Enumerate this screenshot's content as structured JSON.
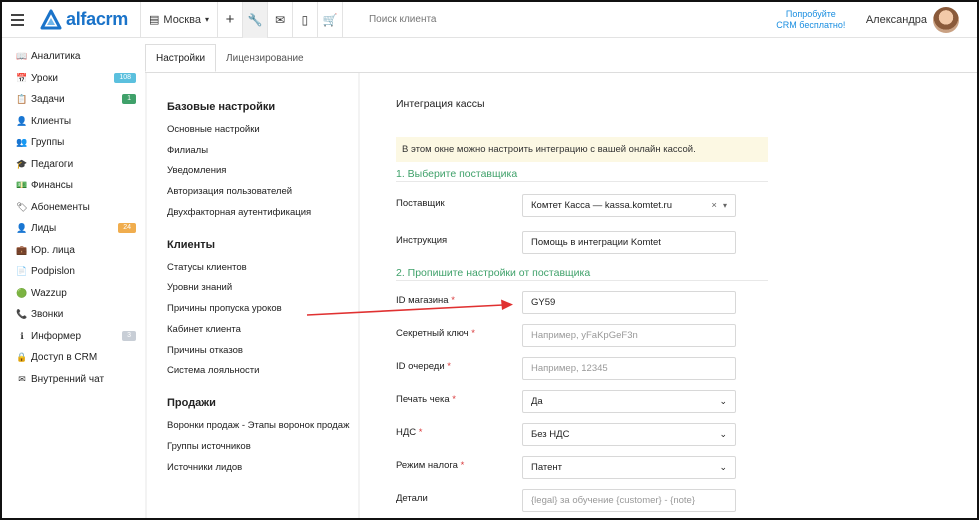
{
  "app": {
    "logo_text": "alfacrm",
    "city": "Москва",
    "search_placeholder": "Поиск клиента",
    "try_free_line1": "Попробуйте",
    "try_free_line2": "CRM бесплатно!",
    "user_name": "Александра",
    "accent": "#1a73c9"
  },
  "sidebar": {
    "items": [
      {
        "label": "Аналитика",
        "icon": "book-icon",
        "glyph": "📖"
      },
      {
        "label": "Уроки",
        "icon": "calendar-icon",
        "glyph": "📅",
        "badge": "108",
        "badge_color": "#5bc0de"
      },
      {
        "label": "Задачи",
        "icon": "clipboard-icon",
        "glyph": "📋",
        "badge": "1",
        "badge_color": "#3fa16a"
      },
      {
        "label": "Клиенты",
        "icon": "user-icon",
        "glyph": "👤"
      },
      {
        "label": "Группы",
        "icon": "users-icon",
        "glyph": "👥"
      },
      {
        "label": "Педагоги",
        "icon": "graduation-cap-icon",
        "glyph": "🎓"
      },
      {
        "label": "Финансы",
        "icon": "money-icon",
        "glyph": "💵"
      },
      {
        "label": "Абонементы",
        "icon": "tag-icon",
        "glyph": "🏷"
      },
      {
        "label": "Лиды",
        "icon": "user-plus-icon",
        "glyph": "👤",
        "badge": "24",
        "badge_color": "#f0ad4e"
      },
      {
        "label": "Юр. лица",
        "icon": "briefcase-icon",
        "glyph": "💼"
      },
      {
        "label": "Podpislon",
        "icon": "file-icon",
        "glyph": "📄"
      },
      {
        "label": "Wazzup",
        "icon": "whatsapp-icon",
        "glyph": "🟢"
      },
      {
        "label": "Звонки",
        "icon": "phone-icon",
        "glyph": "📞"
      },
      {
        "label": "Информер",
        "icon": "info-icon",
        "glyph": "ℹ",
        "badge": "3",
        "badge_color": "#c8ced6"
      },
      {
        "label": "Доступ в CRM",
        "icon": "lock-icon",
        "glyph": "🔒"
      },
      {
        "label": "Внутренний чат",
        "icon": "envelope-icon",
        "glyph": "✉"
      }
    ]
  },
  "tabs": [
    {
      "label": "Настройки",
      "active": true
    },
    {
      "label": "Лицензирование",
      "active": false
    }
  ],
  "settings_menu": [
    {
      "title": "Базовые настройки",
      "links": [
        "Основные настройки",
        "Филиалы",
        "Уведомления",
        "Авторизация пользователей",
        "Двухфакторная аутентификация"
      ]
    },
    {
      "title": "Клиенты",
      "links": [
        "Статусы клиентов",
        "Уровни знаний",
        "Причины пропуска уроков",
        "Кабинет клиента",
        "Причины отказов",
        "Система лояльности"
      ]
    },
    {
      "title": "Продажи",
      "links": [
        "Воронки продаж - Этапы воронок продаж",
        "Группы источников",
        "Источники лидов"
      ]
    }
  ],
  "form": {
    "title": "Интеграция кассы",
    "alert": "В этом окне можно настроить интеграцию с вашей онлайн кассой.",
    "section1": "1. Выберите поставщика",
    "section2": "2. Пропишите настройки от поставщика",
    "provider_label": "Поставщик",
    "provider_value": "Комтет Касса — kassa.komtet.ru",
    "instruction_label": "Инструкция",
    "instruction_value": "Помощь в интеграции Komtet",
    "shop_id_label": "ID магазина",
    "shop_id_value": "GY59",
    "secret_label": "Секретный ключ",
    "secret_placeholder": "Например, yFaKpGeF3n",
    "queue_label": "ID очереди",
    "queue_placeholder": "Например, 12345",
    "print_label": "Печать чека",
    "print_value": "Да",
    "vat_label": "НДС",
    "vat_value": "Без НДС",
    "tax_label": "Режим налога",
    "tax_value": "Патент",
    "details_label": "Детали",
    "details_placeholder": "{legal} за обучение {customer} - {note}",
    "required_mark": "*"
  }
}
